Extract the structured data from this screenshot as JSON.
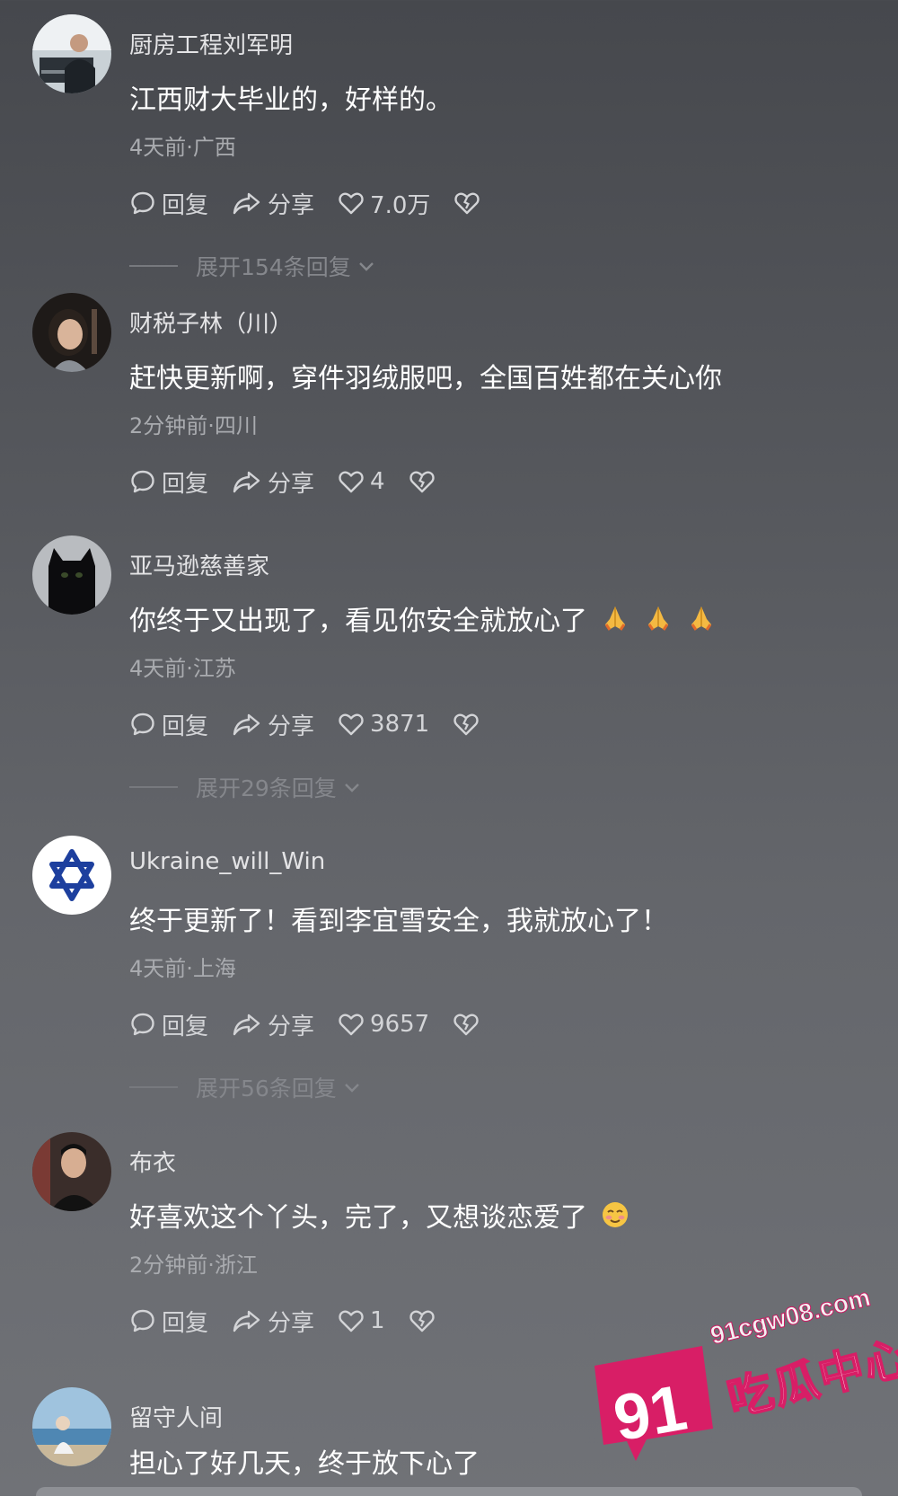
{
  "comments": [
    {
      "username": "厨房工程刘军明",
      "text": "江西财大毕业的，好样的。",
      "meta": "4天前·广西",
      "reply_label": "回复",
      "share_label": "分享",
      "likes": "7.0万",
      "expand": "展开154条回复",
      "avatar_icon": "person-office-photo"
    },
    {
      "username": "财税子林（川）",
      "text": "赶快更新啊，穿件羽绒服吧，全国百姓都在关心你",
      "meta": "2分钟前·四川",
      "reply_label": "回复",
      "share_label": "分享",
      "likes": "4",
      "avatar_icon": "woman-portrait-photo"
    },
    {
      "username": "亚马逊慈善家",
      "text": "你终于又出现了，看见你安全就放心了",
      "text_emoji": "folded-hands-emoji",
      "meta": "4天前·江苏",
      "reply_label": "回复",
      "share_label": "分享",
      "likes": "3871",
      "expand": "展开29条回复",
      "avatar_icon": "black-cat-photo"
    },
    {
      "username": "Ukraine_will_Win",
      "text": "终于更新了！看到李宜雪安全，我就放心了！",
      "meta": "4天前·上海",
      "reply_label": "回复",
      "share_label": "分享",
      "likes": "9657",
      "expand": "展开56条回复",
      "avatar_icon": "star-of-david-flag"
    },
    {
      "username": "布衣",
      "text": "好喜欢这个丫头，完了，又想谈恋爱了",
      "text_emoji": "blushing-face-emoji",
      "meta": "2分钟前·浙江",
      "reply_label": "回复",
      "share_label": "分享",
      "likes": "1",
      "avatar_icon": "man-portrait-photo"
    },
    {
      "username": "留守人间",
      "text": "担心了好几天，终于放下心了",
      "avatar_icon": "seaside-person-photo"
    }
  ],
  "watermark": {
    "badge_text": "91",
    "url": "91cgw08.com",
    "name": "吃瓜中心",
    "brand_color": "#d81e66"
  },
  "colors": {
    "background_top": "#46484d",
    "background_bottom": "#707277",
    "text_primary": "#ffffff",
    "text_secondary": "#a9abaf"
  }
}
